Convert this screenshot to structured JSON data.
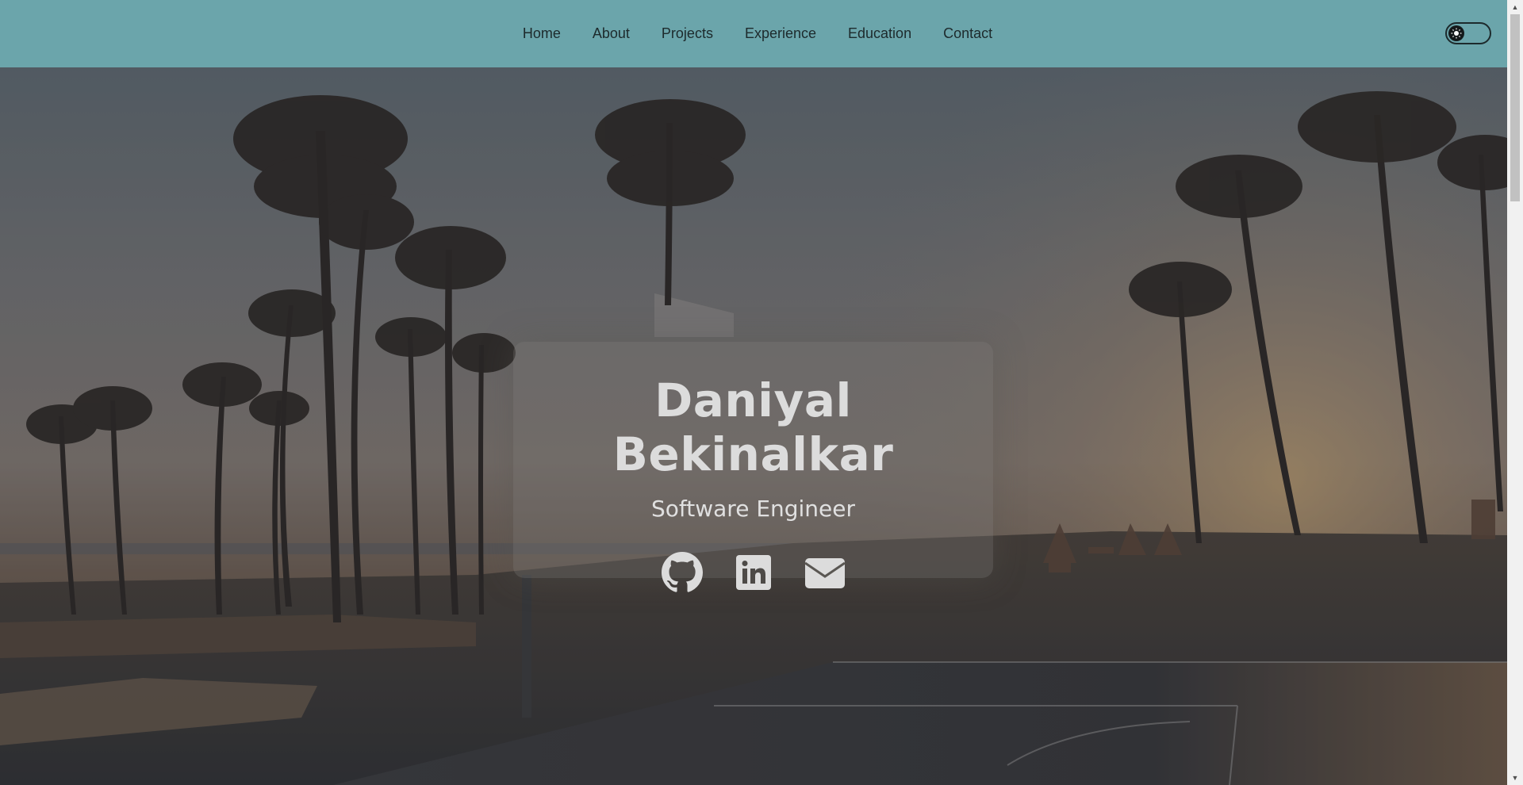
{
  "nav": {
    "links": [
      {
        "label": "Home"
      },
      {
        "label": "About"
      },
      {
        "label": "Projects"
      },
      {
        "label": "Experience"
      },
      {
        "label": "Education"
      },
      {
        "label": "Contact"
      }
    ],
    "theme_toggle_icon": "sun-icon"
  },
  "hero": {
    "name": "Daniyal Bekinalkar",
    "role": "Software Engineer",
    "socials": [
      {
        "icon": "github-icon"
      },
      {
        "icon": "linkedin-icon"
      },
      {
        "icon": "email-icon"
      }
    ],
    "background": "palm-trees-basketball-court-photo"
  },
  "colors": {
    "navbar": "#6ba5ab",
    "nav_text": "#1d2a2c",
    "hero_text": "#dcdcdc"
  }
}
